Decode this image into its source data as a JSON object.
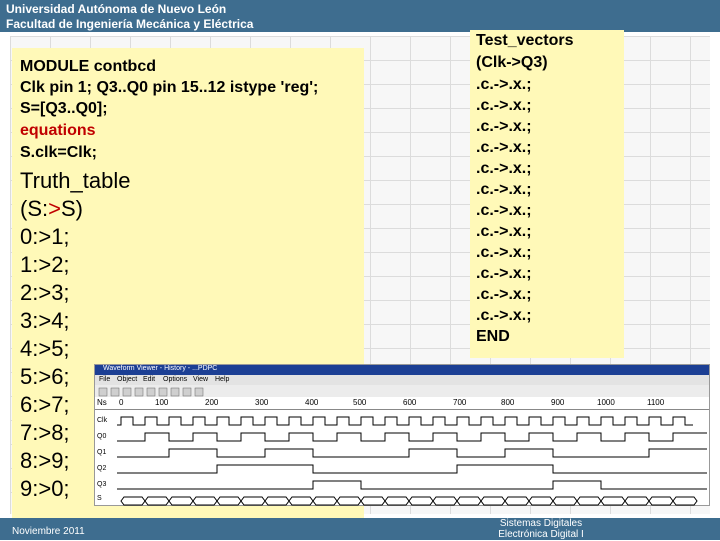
{
  "header": {
    "line1": "Universidad Autónoma de Nuevo León",
    "line2": "Facultad de Ingeniería Mecánica y Eléctrica"
  },
  "footer": {
    "date": "Noviembre 2011",
    "course_line1": "Sistemas Digitales",
    "course_line2": "Electrónica Digital I"
  },
  "code": {
    "module": "MODULE contbcd",
    "pins": "Clk pin 1; Q3..Q0 pin 15..12 istype 'reg';",
    "set": "S=[Q3..Q0];",
    "equations": "equations",
    "clk": "S.clk=Clk;"
  },
  "truth_table": {
    "title": "Truth_table",
    "header_left": "(S:",
    "header_arrow": ">",
    "header_right": "S)",
    "rows": [
      "0:>1;",
      "1:>2;",
      "2:>3;",
      "3:>4;",
      "4:>5;",
      "5:>6;",
      "6:>7;",
      "7:>8;",
      "8:>9;",
      "9:>0;"
    ]
  },
  "test_vectors": {
    "title": "Test_vectors",
    "header": "(Clk->Q3)",
    "rows": [
      ".c.->.x.;",
      ".c.->.x.;",
      ".c.->.x.;",
      ".c.->.x.;",
      ".c.->.x.;",
      ".c.->.x.;",
      ".c.->.x.;",
      ".c.->.x.;",
      ".c.->.x.;",
      ".c.->.x.;",
      ".c.->.x.;",
      ".c.->.x.;"
    ],
    "end": "END"
  },
  "waveform": {
    "title": "Waveform Viewer - History - ...PDPC",
    "menu": [
      "File",
      "Object",
      "Edit",
      "Options",
      "View",
      "Help"
    ],
    "ticks": [
      "0",
      "100",
      "200",
      "300",
      "400",
      "500",
      "600",
      "700",
      "800",
      "900",
      "1000",
      "1100"
    ],
    "unit": "Ns",
    "signals": [
      "Clk",
      "Q0",
      "Q1",
      "Q2",
      "Q3",
      "S"
    ],
    "colors": {
      "title_bar": "#1c3f94",
      "trace": "#000000"
    }
  },
  "colors": {
    "header_bg": "#3e6d8f",
    "panel_bg": "#fff9b8",
    "accent_red": "#c00000"
  }
}
